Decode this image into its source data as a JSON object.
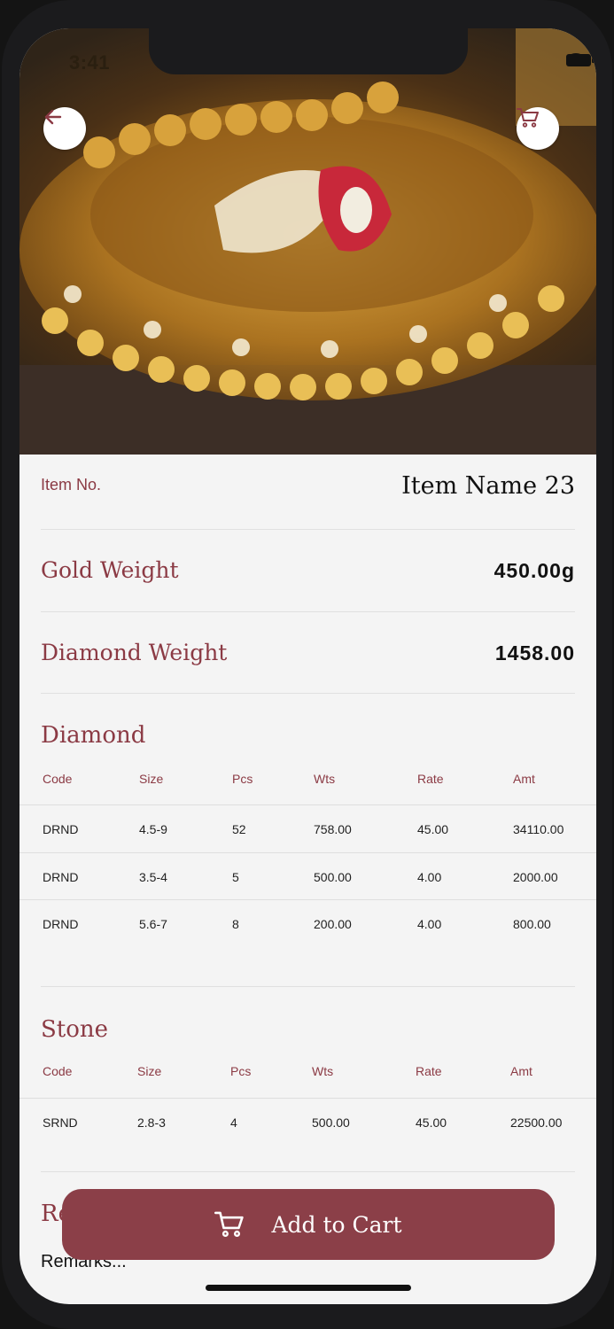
{
  "status": {
    "time": "3:41"
  },
  "item": {
    "no_label": "Item No.",
    "name": "Item Name 23"
  },
  "properties": [
    {
      "label": "Gold Weight",
      "value": "450.00g"
    },
    {
      "label": "Diamond Weight",
      "value": "1458.00"
    }
  ],
  "diamond": {
    "title": "Diamond",
    "columns": [
      "Code",
      "Size",
      "Pcs",
      "Wts",
      "Rate",
      "Amt"
    ],
    "rows": [
      [
        "DRND",
        "4.5-9",
        "52",
        "758.00",
        "45.00",
        "34110.00"
      ],
      [
        "DRND",
        "3.5-4",
        "5",
        "500.00",
        "4.00",
        "2000.00"
      ],
      [
        "DRND",
        "5.6-7",
        "8",
        "200.00",
        "4.00",
        "800.00"
      ]
    ]
  },
  "stone": {
    "title": "Stone",
    "columns": [
      "Code",
      "Size",
      "Pcs",
      "Wts",
      "Rate",
      "Amt"
    ],
    "rows": [
      [
        "SRND",
        "2.8-3",
        "4",
        "500.00",
        "45.00",
        "22500.00"
      ]
    ]
  },
  "remarks": {
    "title": "Remarks",
    "placeholder": "Remarks..."
  },
  "actions": {
    "add_to_cart": "Add to Cart"
  },
  "icons": {
    "back": "arrow-left-icon",
    "cart": "cart-icon"
  },
  "colors": {
    "accent": "#8b3f48",
    "background": "#f4f4f4"
  }
}
